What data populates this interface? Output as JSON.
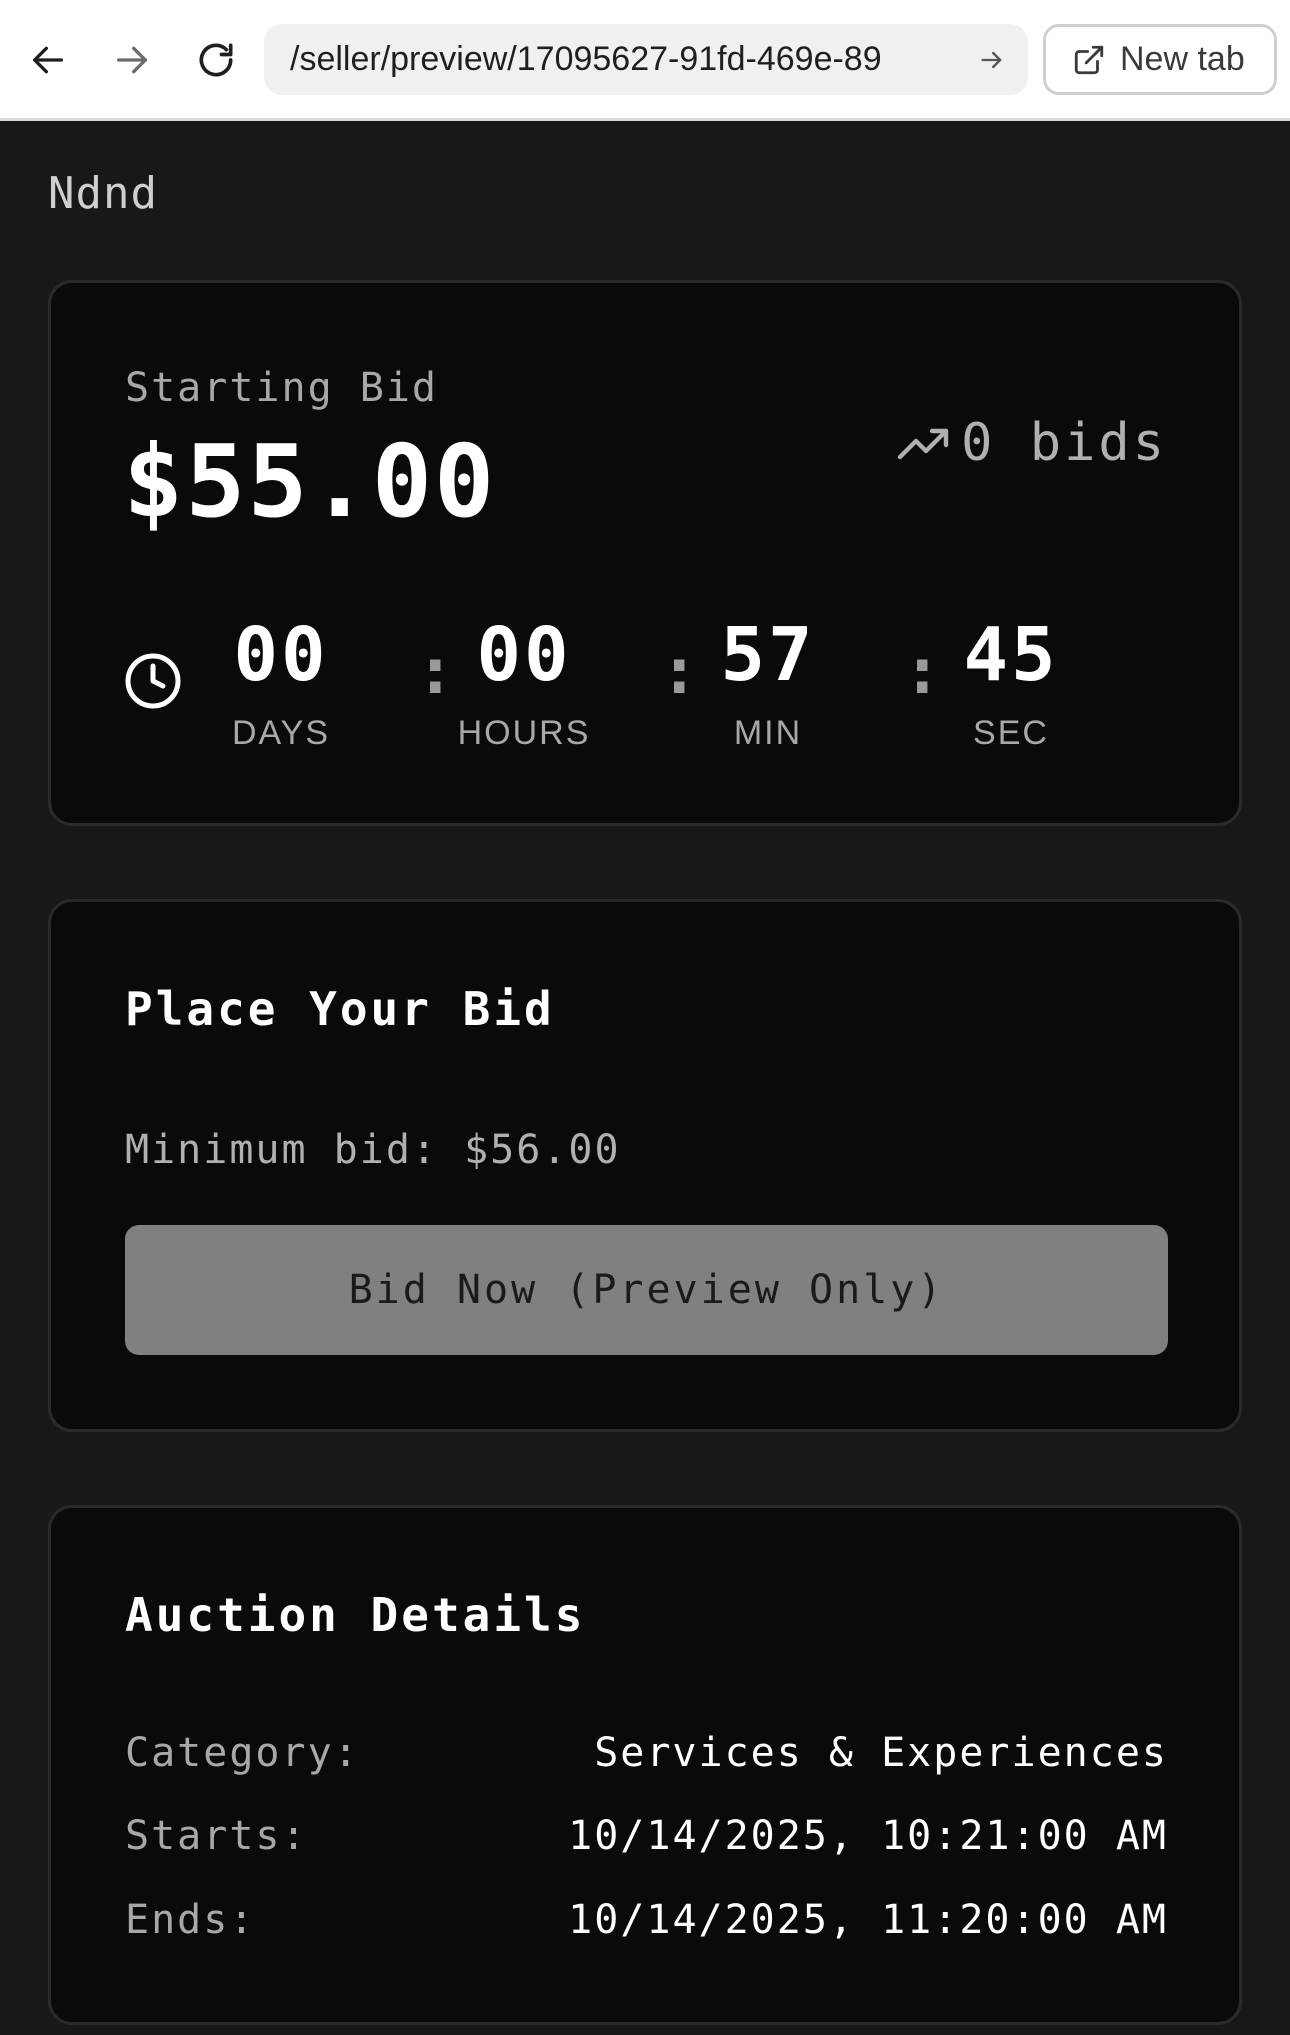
{
  "browser": {
    "url": "/seller/preview/17095627-91fd-469e-89",
    "new_tab_label": "New tab",
    "icons": [
      "back-arrow-icon",
      "forward-arrow-icon",
      "reload-icon",
      "go-arrow-icon",
      "external-link-icon"
    ]
  },
  "page": {
    "item_title": "Ndnd"
  },
  "bid_summary": {
    "starting_label": "Starting Bid",
    "starting_value": "$55.00",
    "bids_count": "0 bids",
    "trend_icon": "trending-up-icon",
    "clock_icon": "clock-icon"
  },
  "countdown": {
    "days": "00",
    "days_label": "DAYS",
    "hours": "00",
    "hours_label": "HOURS",
    "minutes": "57",
    "minutes_label": "MIN",
    "seconds": "45",
    "seconds_label": "SEC",
    "separator": ":"
  },
  "place_bid": {
    "title": "Place Your Bid",
    "minimum_bid": "Minimum bid: $56.00",
    "button_label": "Bid Now (Preview Only)"
  },
  "auction_details": {
    "title": "Auction Details",
    "rows": [
      {
        "label": "Category:",
        "value": "Services & Experiences"
      },
      {
        "label": "Starts:",
        "value": "10/14/2025, 10:21:00 AM"
      },
      {
        "label": "Ends:",
        "value": "10/14/2025, 11:20:00 AM"
      }
    ]
  },
  "colors": {
    "page_background": "#181818",
    "card_background": "#0a0a0c",
    "card_border": "#2a2a2d",
    "button_disabled": "#808080",
    "muted_text": "#a8a8a8"
  }
}
